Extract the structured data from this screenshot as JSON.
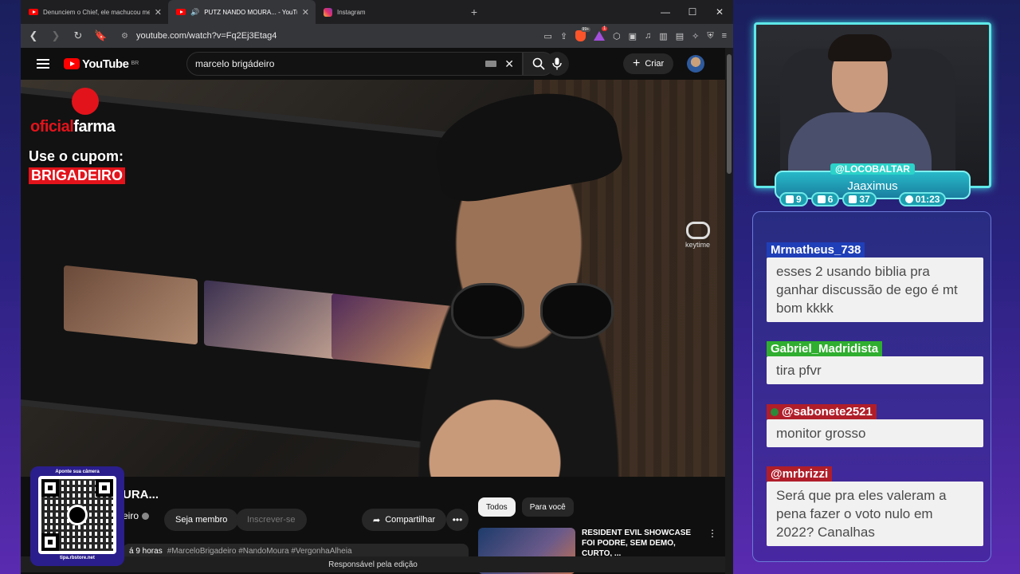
{
  "browser": {
    "tabs": [
      {
        "title": "Denunciem o Chief, ele machucou meus seno",
        "icon": "youtube-icon",
        "active": false
      },
      {
        "title": "PUTZ NANDO MOURA... - YouTube",
        "icon": "youtube-icon",
        "active": true
      },
      {
        "title": "Instagram",
        "icon": "instagram-icon",
        "active": false
      }
    ],
    "new_tab": "+",
    "window_controls": {
      "minimize": "—",
      "maximize": "☐",
      "close": "✕"
    },
    "url": "youtube.com/watch?v=Fq2Ej3Etag4",
    "brave_badge": "99+",
    "rewards_badge": "1",
    "status_text": "Responsável pela edição"
  },
  "youtube": {
    "logo_text": "YouTube",
    "region": "BR",
    "search_value": "marcelo brigádeiro",
    "create_label": "Criar",
    "video": {
      "promo_brand_a": "oficial",
      "promo_brand_b": "farma",
      "promo_line": "Use o cupom:",
      "promo_coupon": "BRIGADEIRO",
      "watermark": "keytime"
    },
    "title": "URA...",
    "channel": "eiro",
    "member_label": "Seja membro",
    "subscribe_label": "Inscrever-se",
    "share_label": "Compartilhar",
    "more_label": "•••",
    "description_time": "á 9 horas",
    "description_tags": "#MarceloBrigadeiro #NandoMoura #VergonhaAlheia",
    "chips": [
      "Todos",
      "Para você"
    ],
    "recommendation": {
      "title": "RESIDENT EVIL SHOWCASE FOI PODRE, SEM DEMO, CURTO, ..."
    }
  },
  "qr": {
    "top_text": "Aponte sua câmera",
    "bottom_text": "tipa.rbstore.net"
  },
  "streamer": {
    "handle": "@LOCOBALTAR",
    "name": "Jaaximus",
    "stats": [
      {
        "icon": "twitch-icon",
        "value": "9"
      },
      {
        "icon": "youtube-icon",
        "value": "6"
      },
      {
        "icon": "kick-icon",
        "value": "37"
      },
      {
        "icon": "clock-icon",
        "value": "01:23"
      }
    ]
  },
  "chat": {
    "messages": [
      {
        "user": "Mrmatheus_738",
        "text": "esses 2 usando biblia pra ganhar discussão de ego é mt bom kkkk",
        "color": "#1f3fb8"
      },
      {
        "user": "Gabriel_Madridista",
        "text": "tira pfvr",
        "color": "#2fae2f"
      },
      {
        "user": "@sabonete2521",
        "text": "monitor grosso",
        "color": "#b01e2a",
        "moderator": true
      },
      {
        "user": "@mrbrizzi",
        "text": "Será que pra eles valeram a pena fazer o voto nulo em 2022? Canalhas",
        "color": "#b01e2a"
      }
    ]
  }
}
